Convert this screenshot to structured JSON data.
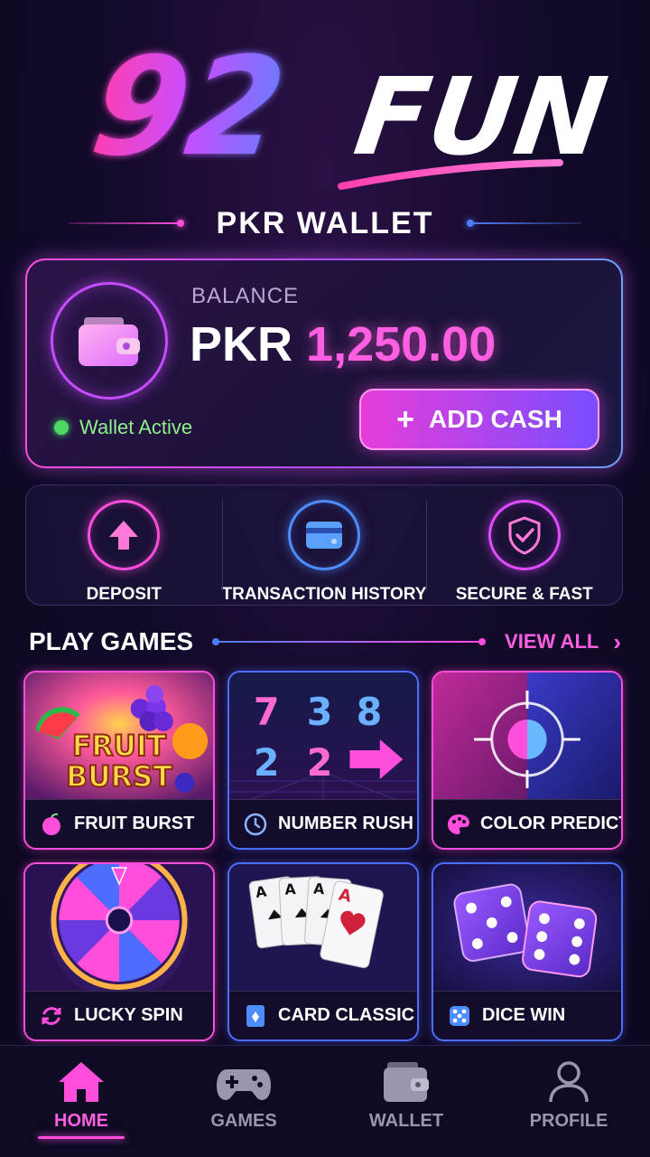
{
  "logo": {
    "number": "92",
    "word": "FUN"
  },
  "wallet": {
    "title": "PKR WALLET",
    "balance_label": "BALANCE",
    "currency": "PKR",
    "amount": "1,250.00",
    "status": "Wallet Active",
    "add_cash_label": "ADD CASH"
  },
  "actions": [
    {
      "label": "DEPOSIT",
      "icon": "arrow-up-icon",
      "color": "#ff4ddc"
    },
    {
      "label": "TRANSACTION HISTORY",
      "icon": "card-icon",
      "color": "#4d8dff"
    },
    {
      "label": "SECURE & FAST",
      "icon": "shield-check-icon",
      "color": "#e04dff"
    }
  ],
  "games_section": {
    "title": "PLAY GAMES",
    "view_all": "VIEW ALL"
  },
  "games": [
    {
      "name": "FRUIT BURST",
      "art_text_1": "FRUIT",
      "art_text_2": "BURST",
      "icon": "fruit-icon"
    },
    {
      "name": "NUMBER RUSH",
      "digits": [
        "7",
        "3",
        "8",
        "2",
        "2"
      ],
      "icon": "clock-icon"
    },
    {
      "name": "COLOR PREDICT",
      "icon": "palette-icon"
    },
    {
      "name": "LUCKY SPIN",
      "icon": "refresh-icon"
    },
    {
      "name": "CARD CLASSIC",
      "card_rank": "A",
      "icon": "playing-card-icon"
    },
    {
      "name": "DICE WIN",
      "icon": "dice-icon"
    }
  ],
  "nav": [
    {
      "label": "HOME",
      "icon": "home-icon",
      "active": true
    },
    {
      "label": "GAMES",
      "icon": "gamepad-icon",
      "active": false
    },
    {
      "label": "WALLET",
      "icon": "wallet-icon",
      "active": false
    },
    {
      "label": "PROFILE",
      "icon": "user-icon",
      "active": false
    }
  ],
  "colors": {
    "pink": "#ff4ddc",
    "blue": "#4d7dff",
    "purple": "#8a4dff",
    "green": "#4cd964"
  }
}
